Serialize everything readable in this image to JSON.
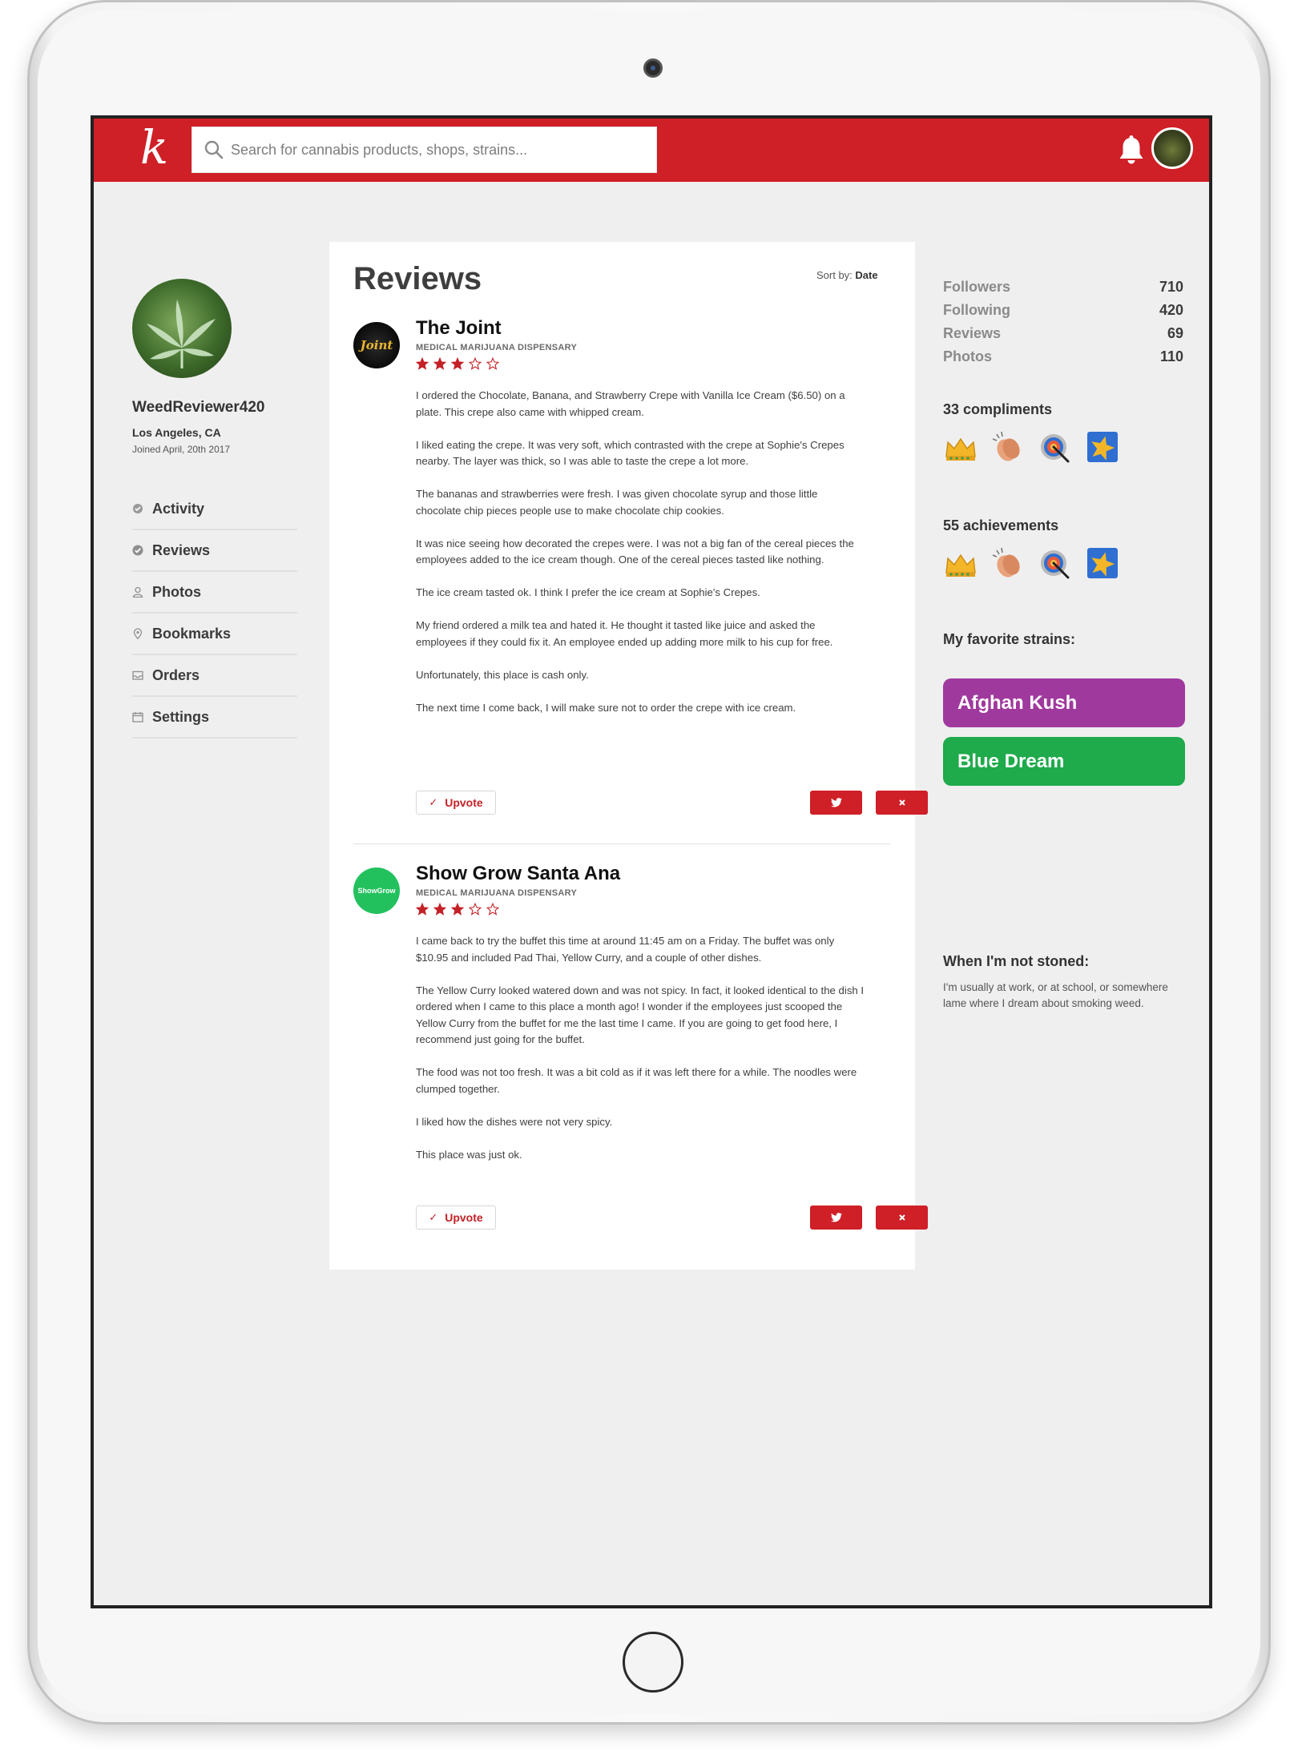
{
  "app": {
    "logo_text": "k",
    "search_placeholder": "Search for cannabis products, shops, strains..."
  },
  "profile": {
    "username": "WeedReviewer420",
    "location": "Los Angeles, CA",
    "joined": "Joined April, 20th 2017"
  },
  "nav": [
    {
      "label": "Activity",
      "icon": "activity-icon"
    },
    {
      "label": "Reviews",
      "icon": "check-circle-icon"
    },
    {
      "label": "Photos",
      "icon": "user-icon"
    },
    {
      "label": "Bookmarks",
      "icon": "pin-icon"
    },
    {
      "label": "Orders",
      "icon": "inbox-icon"
    },
    {
      "label": "Settings",
      "icon": "calendar-icon"
    }
  ],
  "reviews_section": {
    "title": "Reviews",
    "sort_label": "Sort by:",
    "sort_value": "Date"
  },
  "reviews": [
    {
      "name": "The Joint",
      "type": "MEDICAL MARIJUANA DISPENSARY",
      "rating": 3,
      "max_rating": 5,
      "logo_text": "Joint",
      "paragraphs": [
        "I ordered the Chocolate, Banana, and Strawberry Crepe with Vanilla Ice Cream ($6.50) on a plate. This crepe also came with whipped cream.",
        "I liked eating the crepe. It was very soft, which contrasted with the crepe at Sophie's Crepes nearby. The layer was thick, so I was able to taste the crepe a lot more.",
        "The bananas and strawberries were fresh. I was given chocolate syrup and those little chocolate chip pieces people use to make chocolate chip cookies.",
        "It was nice seeing how decorated the crepes were. I was not a big fan of the cereal pieces the employees added to the ice cream though. One of the cereal pieces tasted like nothing.",
        "The ice cream tasted ok. I think I prefer the ice cream at Sophie's Crepes.",
        "My friend ordered a milk tea and hated it. He thought it tasted like juice and asked the employees if they could fix it. An employee ended up adding more milk to his cup for free.",
        "Unfortunately, this place is cash only.",
        "The next time I come back, I will make sure not to order the crepe with ice cream."
      ],
      "upvote_label": "Upvote"
    },
    {
      "name": "Show Grow Santa Ana",
      "type": "MEDICAL MARIJUANA DISPENSARY",
      "rating": 3,
      "max_rating": 5,
      "logo_text": "ShowGrow",
      "paragraphs": [
        "I came back to try the buffet this time at around 11:45 am on a Friday. The buffet was only $10.95 and included Pad Thai, Yellow Curry, and a couple of other dishes.",
        "The Yellow Curry looked watered down and was not spicy. In fact, it looked identical to the dish I ordered when I came to this place a month ago! I wonder if the employees just scooped the Yellow Curry from the buffet for me the last time I came. If you are going to get food here, I recommend just going for the buffet.",
        "The food was not too fresh. It was a bit cold as if it was left there for a while. The noodles were clumped together.",
        "I liked how the dishes were not very spicy.",
        "This place was just ok."
      ],
      "upvote_label": "Upvote"
    }
  ],
  "stats": [
    {
      "label": "Followers",
      "value": "710"
    },
    {
      "label": "Following",
      "value": "420"
    },
    {
      "label": "Reviews",
      "value": "69"
    },
    {
      "label": "Photos",
      "value": "110"
    }
  ],
  "compliments": {
    "title": "33 compliments",
    "badges": [
      "crown-icon",
      "clap-icon",
      "target-icon",
      "star-badge-icon"
    ]
  },
  "achievements": {
    "title": "55 achievements",
    "badges": [
      "crown-icon",
      "clap-icon",
      "target-icon",
      "star-badge-icon"
    ]
  },
  "favorites": {
    "title": "My favorite strains:",
    "strains": [
      {
        "name": "Afghan Kush",
        "color": "#a0399d"
      },
      {
        "name": "Blue Dream",
        "color": "#1faa4b"
      }
    ]
  },
  "about": {
    "title": "When I'm not stoned:",
    "text": "I'm usually at work, or at school, or somewhere lame where I dream about smoking weed."
  },
  "colors": {
    "brand_red": "#cf1f27",
    "background": "#efefef"
  }
}
